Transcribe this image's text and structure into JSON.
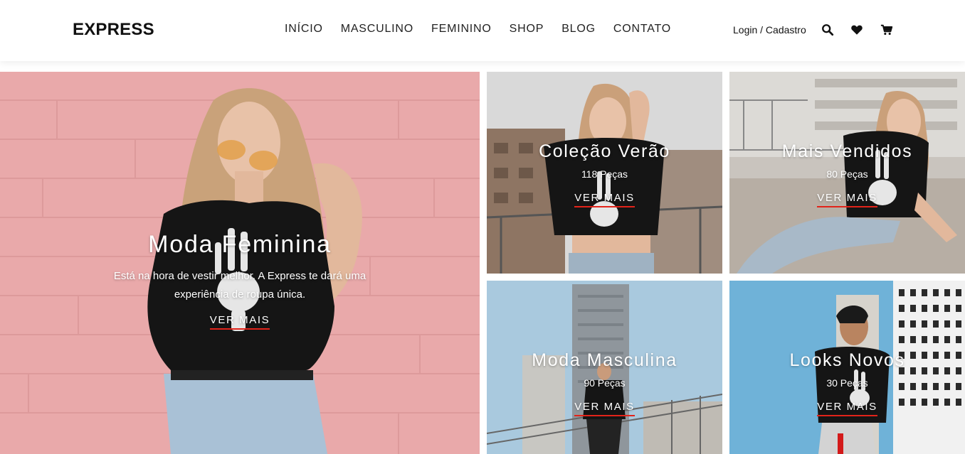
{
  "brand": {
    "logo": "EXPRESS"
  },
  "nav": {
    "items": [
      "INÍCIO",
      "MASCULINO",
      "FEMININO",
      "SHOP",
      "BLOG",
      "CONTATO"
    ]
  },
  "header_actions": {
    "login_label": "Login / Cadastro",
    "icons": [
      "search-icon",
      "heart-icon",
      "cart-icon"
    ]
  },
  "hero": {
    "title": "Moda Feminina",
    "description": "Está na hora de vestir melhor. A Express te dará uma experiência de roupa única.",
    "cta": "VER MAIS"
  },
  "tiles": [
    {
      "title": "Coleção Verão",
      "count": "118 Peças",
      "cta": "VER MAIS"
    },
    {
      "title": "Mais Vendidos",
      "count": "80 Peças",
      "cta": "VER MAIS"
    },
    {
      "title": "Moda Masculina",
      "count": "90 Peças",
      "cta": "VER MAIS"
    },
    {
      "title": "Looks Novos",
      "count": "30 Peças",
      "cta": "VER MAIS"
    }
  ],
  "colors": {
    "accent_underline": "#e2231a",
    "hero_wall": "#e9a9aa",
    "sky": "#7fb6d6"
  }
}
